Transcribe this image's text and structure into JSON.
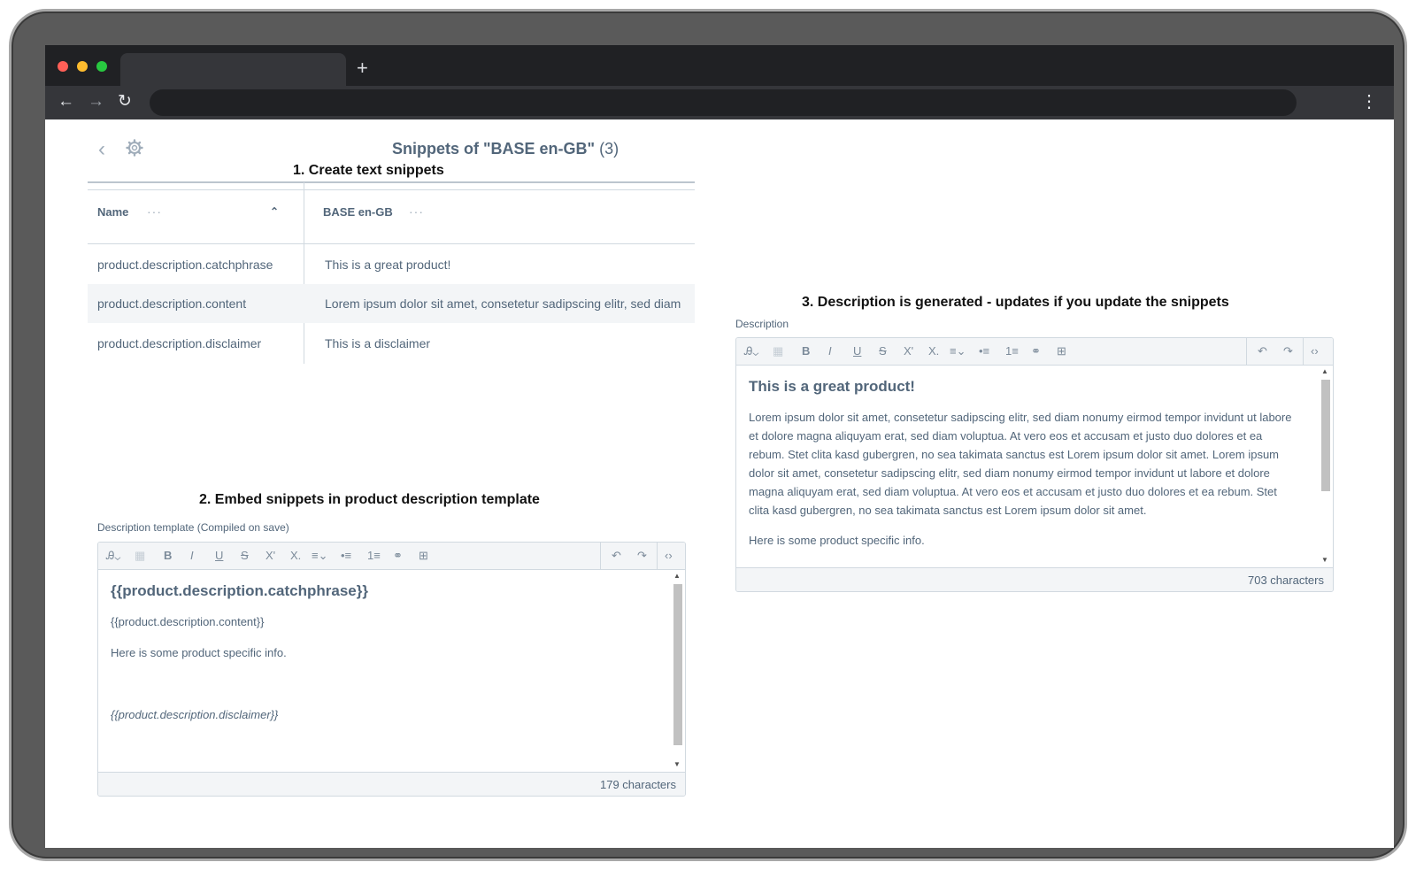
{
  "browser": {
    "traffic_colors": {
      "close": "#ff5f57",
      "minimize": "#febc2e",
      "maximize": "#28c840"
    },
    "new_tab": "+",
    "back": "←",
    "forward": "→",
    "reload": "↻",
    "menu": "⋮"
  },
  "step1": {
    "heading": "1. Create text snippets"
  },
  "snippets": {
    "title": "Snippets of \"BASE en-GB\"",
    "count": "(3)",
    "columns": {
      "name": "Name",
      "base": "BASE en-GB"
    },
    "rows": [
      {
        "name": "product.description.catchphrase",
        "value": "This is a great product!"
      },
      {
        "name": "product.description.content",
        "value": "Lorem ipsum dolor sit amet, consetetur sadipscing elitr, sed diam"
      },
      {
        "name": "product.description.disclaimer",
        "value": "This is a disclaimer"
      }
    ]
  },
  "step2": {
    "heading": "2. Embed snippets in product description template",
    "label": "Description template (Compiled on save)",
    "line1": "{{product.description.catchphrase}}",
    "line2": "{{product.description.content}}",
    "line3": "Here is some product specific info.",
    "line4": "{{product.description.disclaimer}}",
    "char_count": "179 characters"
  },
  "step3": {
    "heading": "3. Description is generated - updates if you update the snippets",
    "label": "Description",
    "title": "This is a great product!",
    "body": "Lorem ipsum dolor sit amet, consetetur sadipscing elitr, sed diam nonumy eirmod tempor invidunt ut labore et dolore magna aliquyam erat, sed diam voluptua. At vero eos et accusam et justo duo dolores et ea rebum. Stet clita kasd gubergren, no sea takimata sanctus est Lorem ipsum dolor sit amet. Lorem ipsum dolor sit amet, consetetur sadipscing elitr, sed diam nonumy eirmod tempor invidunt ut labore et dolore magna aliquyam erat, sed diam voluptua. At vero eos et accusam et justo duo dolores et ea rebum. Stet clita kasd gubergren, no sea takimata sanctus est Lorem ipsum dolor sit amet.",
    "extra": "Here is some product specific info.",
    "char_count": "703 characters"
  },
  "toolbar_icons": {
    "format": "Ꭿ⌄",
    "clear": "▦",
    "bold": "B",
    "italic": "I",
    "underline": "U",
    "strike": "S",
    "sup": "X'",
    "sub": "X.",
    "align": "≡⌄",
    "ul": "•≡",
    "ol": "1≡",
    "link": "⚭",
    "table": "⊞",
    "undo": "↶",
    "redo": "↷",
    "code": "‹›"
  }
}
